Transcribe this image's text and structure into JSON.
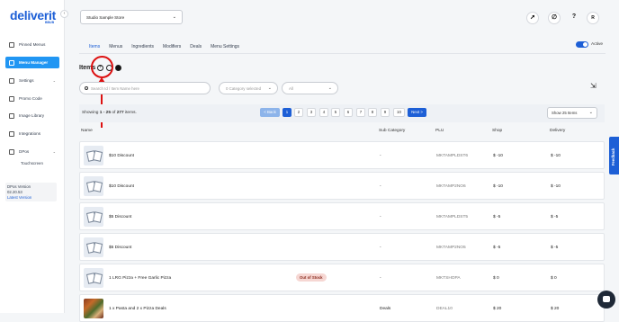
{
  "app": {
    "logo": "deliverit",
    "logo_sub": "BBUB"
  },
  "sidebar": {
    "items": [
      {
        "label": "Pinned Menus",
        "icon": "pin-icon"
      },
      {
        "label": "Menu Manager",
        "icon": "menu-icon"
      },
      {
        "label": "Settings",
        "icon": "gear-icon"
      },
      {
        "label": "Promo Code",
        "icon": "tag-icon"
      },
      {
        "label": "Image Library",
        "icon": "image-icon"
      },
      {
        "label": "Integrations",
        "icon": "plug-icon"
      },
      {
        "label": "DPos",
        "icon": "pos-icon"
      }
    ],
    "subitem": "Touchscreen",
    "version": {
      "label": "DPos Version",
      "number": "02.20.53",
      "latest": "Latest Version"
    }
  },
  "header": {
    "store_select": "Studio Sample Store",
    "avatar_initial": "R",
    "help_label": "?"
  },
  "tabs": [
    "Items",
    "Menus",
    "Ingredients",
    "Modifiers",
    "Deals",
    "Menu Settings"
  ],
  "toggle_label": "Active",
  "items_title": "Items",
  "filters": {
    "search_placeholder": "Search Id / Item Name here",
    "category_placeholder": "0 Category selected",
    "status_value": "All"
  },
  "pagination": {
    "showing_prefix": "Showing ",
    "range": "1 - 25",
    "of": " of ",
    "total": "277",
    "suffix": " items.",
    "back": "< Back",
    "pages": [
      "1",
      "2",
      "3",
      "4",
      "5",
      "6",
      "7",
      "8",
      "9",
      "10"
    ],
    "next": "Next >",
    "page_size": "Show 25 Items"
  },
  "table": {
    "headers": [
      "Name",
      "Sub Category",
      "PLU",
      "Shop",
      "Delivery"
    ],
    "rows": [
      {
        "name": "$10 Discount",
        "sub": "-",
        "plu": "MKTAMPLDST6",
        "shop": "$ -10",
        "delivery": "$ -10",
        "photo": false,
        "badge": ""
      },
      {
        "name": "$10 Discount",
        "sub": "-",
        "plu": "MKTAMP2NO6",
        "shop": "$ -10",
        "delivery": "$ -10",
        "photo": false,
        "badge": ""
      },
      {
        "name": "$5 Discount",
        "sub": "-",
        "plu": "MKTAMPLDST5",
        "shop": "$ -5",
        "delivery": "$ -5",
        "photo": false,
        "badge": ""
      },
      {
        "name": "$5 Discount",
        "sub": "-",
        "plu": "MKTAMP2NO5",
        "shop": "$ -5",
        "delivery": "$ -5",
        "photo": false,
        "badge": ""
      },
      {
        "name": "1 LRG Pizza + Free Garlic Pizza",
        "sub": "-",
        "plu": "MKTSHOPA",
        "shop": "$ 0",
        "delivery": "$ 0",
        "photo": false,
        "badge": "Out of Stock"
      },
      {
        "name": "1 x Pasta and 2 x Pizza Deals",
        "sub": "Deals",
        "plu": "DEAL10",
        "shop": "$ 20",
        "delivery": "$ 20",
        "photo": true,
        "badge": ""
      }
    ]
  },
  "feedback_label": "Feedback",
  "colors": {
    "accent": "#1d5fd6",
    "annotation": "#dd1111"
  }
}
